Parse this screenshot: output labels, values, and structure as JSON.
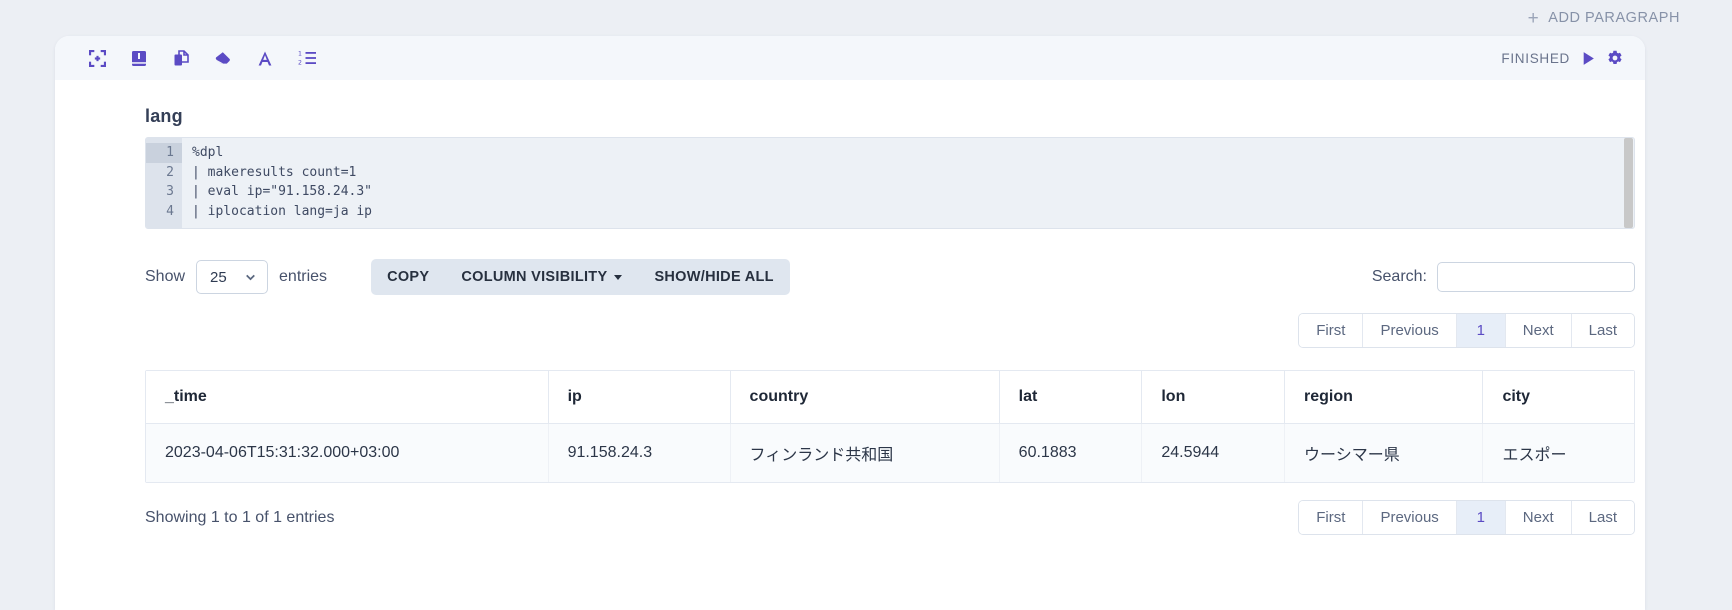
{
  "topbar": {
    "add_paragraph_label": "ADD PARAGRAPH",
    "plus_glyph": "+"
  },
  "toolbar": {
    "icons": [
      {
        "name": "collapse-icon",
        "label": "Collapse"
      },
      {
        "name": "book-icon",
        "label": "Book"
      },
      {
        "name": "copy-icon",
        "label": "Copy"
      },
      {
        "name": "eraser-icon",
        "label": "Clear output"
      },
      {
        "name": "font-size-icon",
        "label": "A"
      },
      {
        "name": "line-numbers-icon",
        "label": "Line numbers"
      }
    ],
    "status": "FINISHED",
    "run_icon": "play-icon",
    "settings_icon": "gear-icon"
  },
  "paragraph": {
    "title": "lang",
    "code_lines": [
      "%dpl",
      "| makeresults count=1",
      "| eval ip=\"91.158.24.3\"",
      "| iplocation lang=ja ip"
    ],
    "line_numbers": [
      "1",
      "2",
      "3",
      "4"
    ],
    "active_line": 1
  },
  "datatable": {
    "show_label": "Show",
    "entries_label": "entries",
    "page_length": "25",
    "buttons": [
      {
        "name": "copy-button",
        "label": "COPY",
        "has_caret": false
      },
      {
        "name": "column-visibility-button",
        "label": "COLUMN VISIBILITY",
        "has_caret": true
      },
      {
        "name": "show-hide-all-button",
        "label": "SHOW/HIDE ALL",
        "has_caret": false
      }
    ],
    "search_label": "Search:",
    "search_value": "",
    "search_placeholder": "",
    "pagination": {
      "first": "First",
      "previous": "Previous",
      "current_page": "1",
      "next": "Next",
      "last": "Last"
    },
    "columns": [
      "_time",
      "ip",
      "country",
      "lat",
      "lon",
      "region",
      "city"
    ],
    "rows": [
      [
        "2023-04-06T15:31:32.000+03:00",
        "91.158.24.3",
        "フィンランド共和国",
        "60.1883",
        "24.5944",
        "ウーシマー県",
        "エスポー"
      ]
    ],
    "info": "Showing 1 to 1 of 1 entries"
  },
  "colors": {
    "accent": "#5b4bc4",
    "page_background": "#eceff4",
    "toolbar_background": "#f4f7fb",
    "row_background": "#f9fbfd",
    "active_page_background": "#e7eef8"
  }
}
